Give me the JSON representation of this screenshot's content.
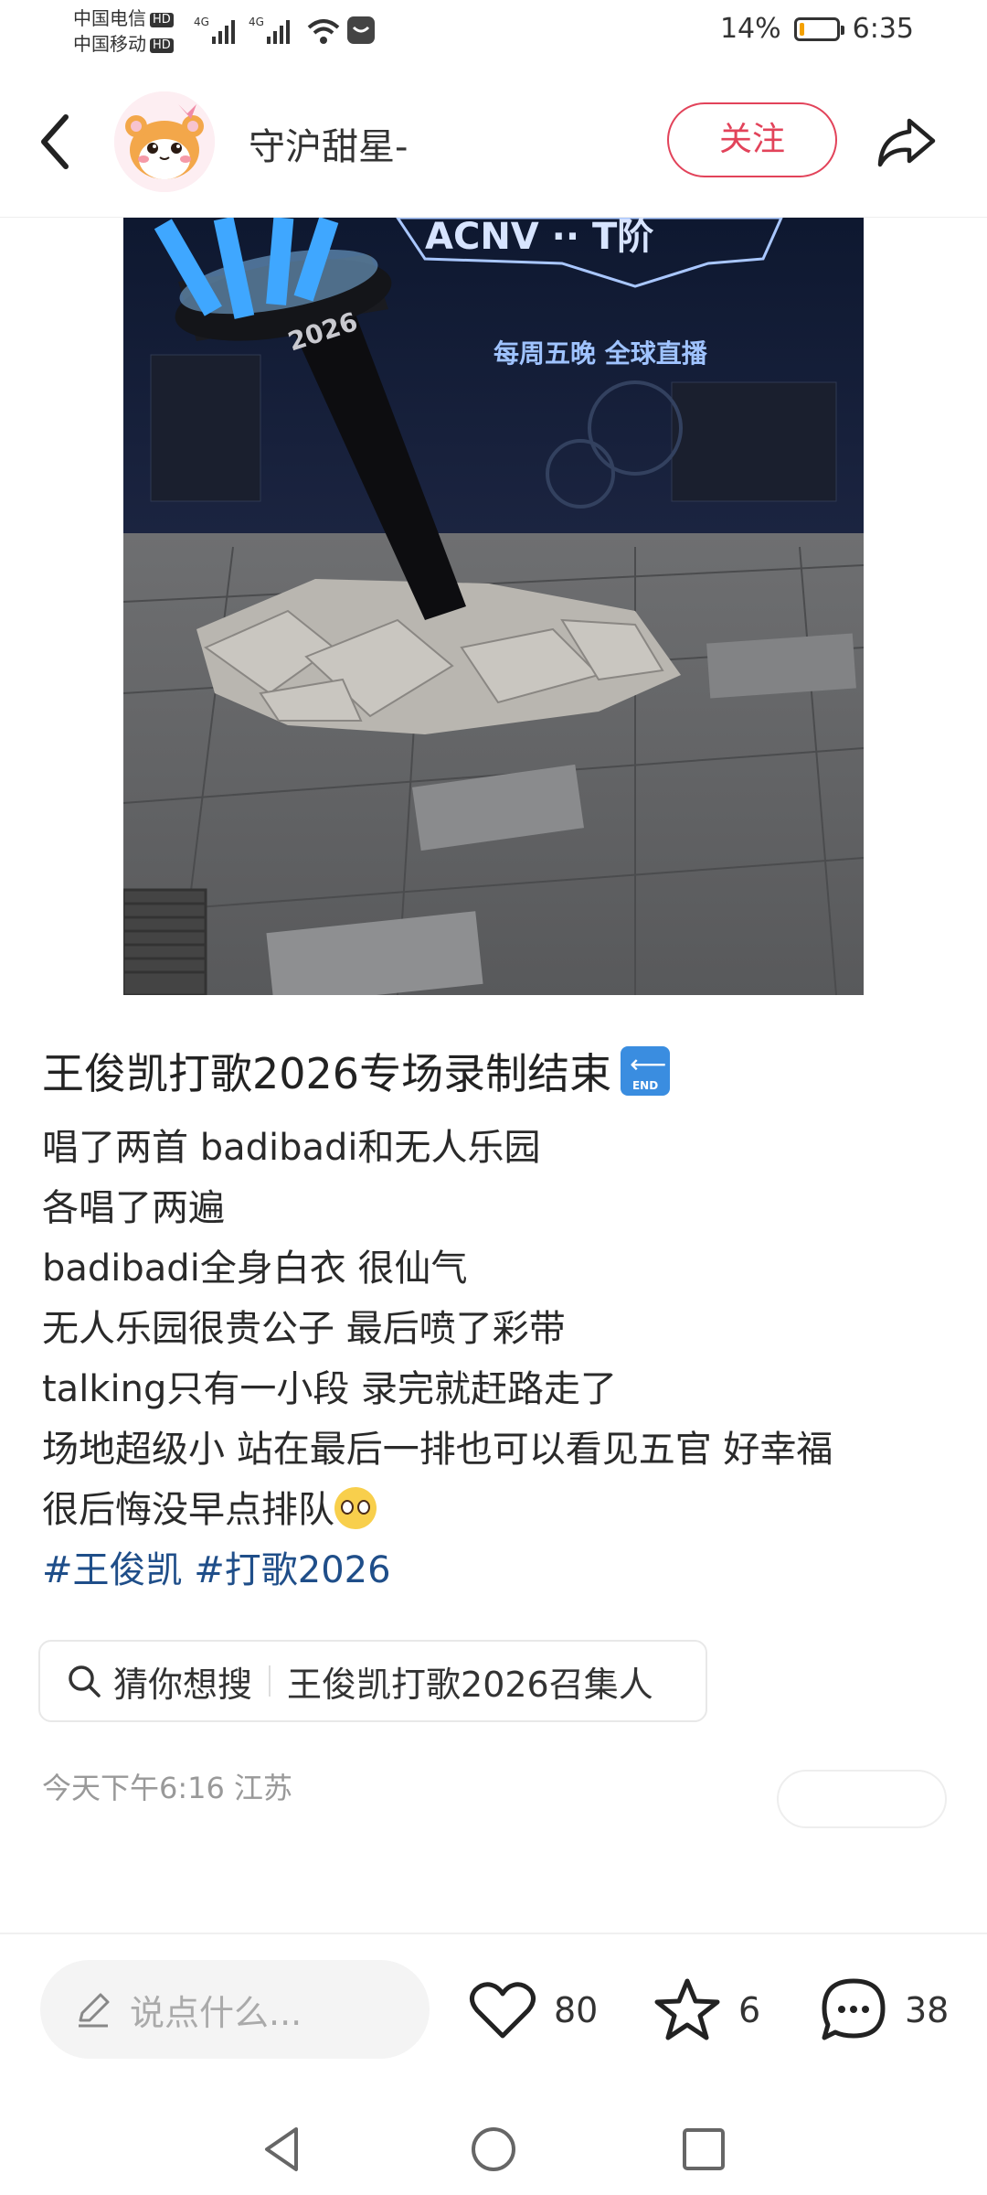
{
  "status_bar": {
    "carrier1": "中国电信",
    "carrier2": "中国移动",
    "hd": "HD",
    "signal_tag": "4G",
    "battery_percent_text": "14%",
    "battery_level": 0.14,
    "time": "6:35"
  },
  "header": {
    "username": "守沪甜星-",
    "follow_label": "关注"
  },
  "post": {
    "title": "王俊凯打歌2026专场录制结束",
    "end_badge": "END",
    "lines": [
      "唱了两首 badibadi和无人乐园",
      "各唱了两遍",
      "badibadi全身白衣 很仙气",
      "无人乐园很贵公子 最后喷了彩带",
      "talking只有一小段 录完就赶路走了",
      "场地超级小 站在最后一排也可以看见五官 好幸福",
      "很后悔没早点排队"
    ],
    "tags": "#王俊凯 #打歌2026",
    "photo": {
      "backdrop_text": "每周五晚  全球直播",
      "lightstick_text": "2026"
    }
  },
  "suggest": {
    "label": "猜你想搜",
    "query": "王俊凯打歌2026召集人"
  },
  "meta": {
    "time_location": "今天下午6:16 江苏"
  },
  "bottom_bar": {
    "comment_placeholder": "说点什么...",
    "likes": "80",
    "favorites": "6",
    "comments": "38"
  },
  "colors": {
    "accent": "#e2435a",
    "tag": "#1f4e89"
  }
}
